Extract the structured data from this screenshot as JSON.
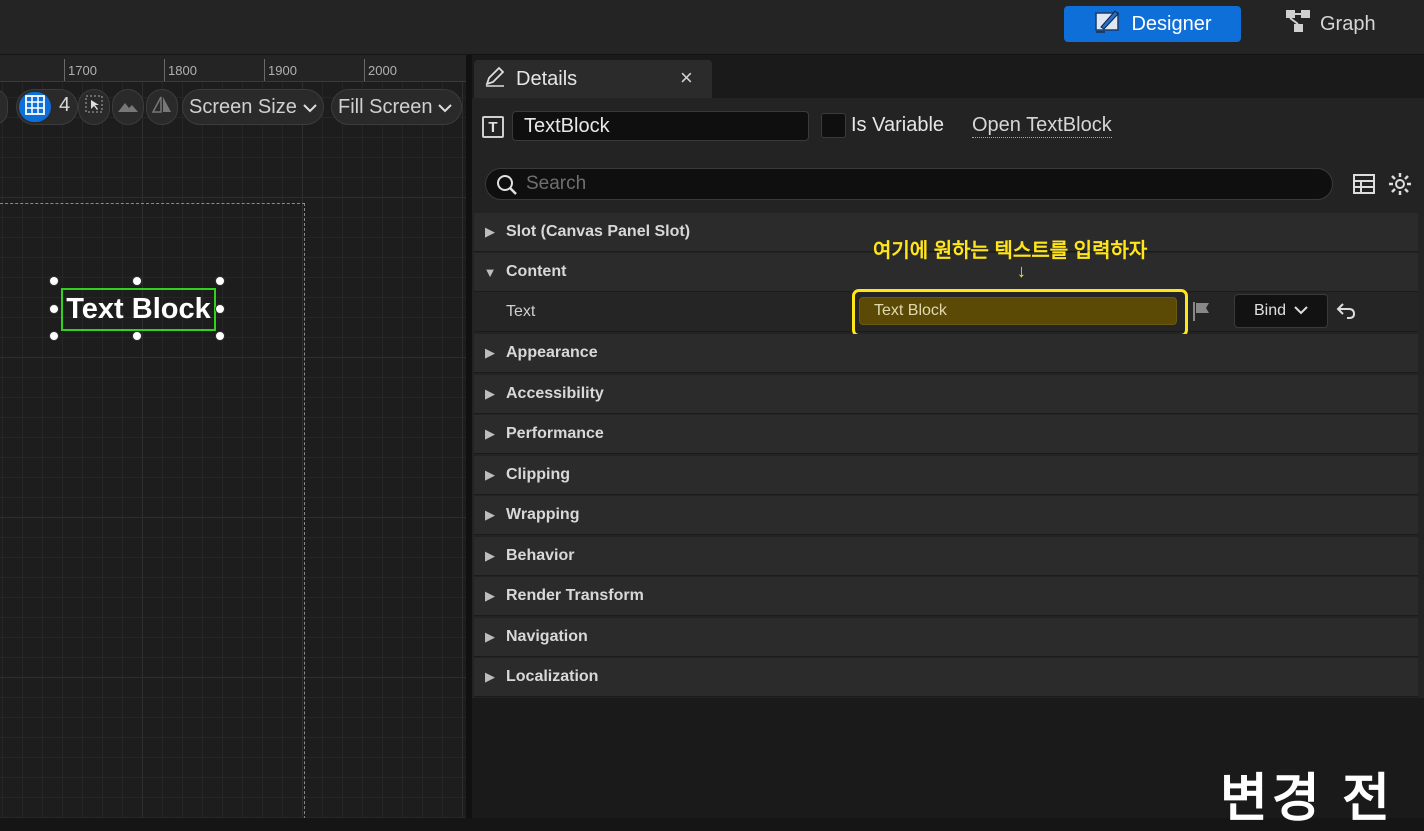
{
  "header": {
    "designer_label": "Designer",
    "graph_label": "Graph"
  },
  "canvas": {
    "ruler_ticks": [
      "1700",
      "1800",
      "1900",
      "2000"
    ],
    "grid_count": "4",
    "screen_size_label": "Screen Size",
    "fill_screen_label": "Fill Screen",
    "widget_text": "Text Block"
  },
  "details": {
    "tab_label": "Details",
    "close_glyph": "×",
    "widget_name": "TextBlock",
    "is_variable_label": "Is Variable",
    "open_link_label": "Open TextBlock",
    "search_placeholder": "Search",
    "sections": [
      {
        "label": "Slot (Canvas Panel Slot)",
        "expanded": false
      },
      {
        "label": "Content",
        "expanded": true
      },
      {
        "label": "Appearance",
        "expanded": false
      },
      {
        "label": "Accessibility",
        "expanded": false
      },
      {
        "label": "Performance",
        "expanded": false
      },
      {
        "label": "Clipping",
        "expanded": false
      },
      {
        "label": "Wrapping",
        "expanded": false
      },
      {
        "label": "Behavior",
        "expanded": false
      },
      {
        "label": "Render Transform",
        "expanded": false
      },
      {
        "label": "Navigation",
        "expanded": false
      },
      {
        "label": "Localization",
        "expanded": false
      }
    ],
    "text_property": {
      "label": "Text",
      "value": "Text Block",
      "bind_label": "Bind"
    }
  },
  "annotation": {
    "text": "여기에 원하는 텍스트를 입력하자",
    "arrow": "↓",
    "corner_label": "변경 전"
  },
  "colors": {
    "accent": "#0f6fd8",
    "highlight": "#ffe51a",
    "selection": "#33d11f"
  }
}
